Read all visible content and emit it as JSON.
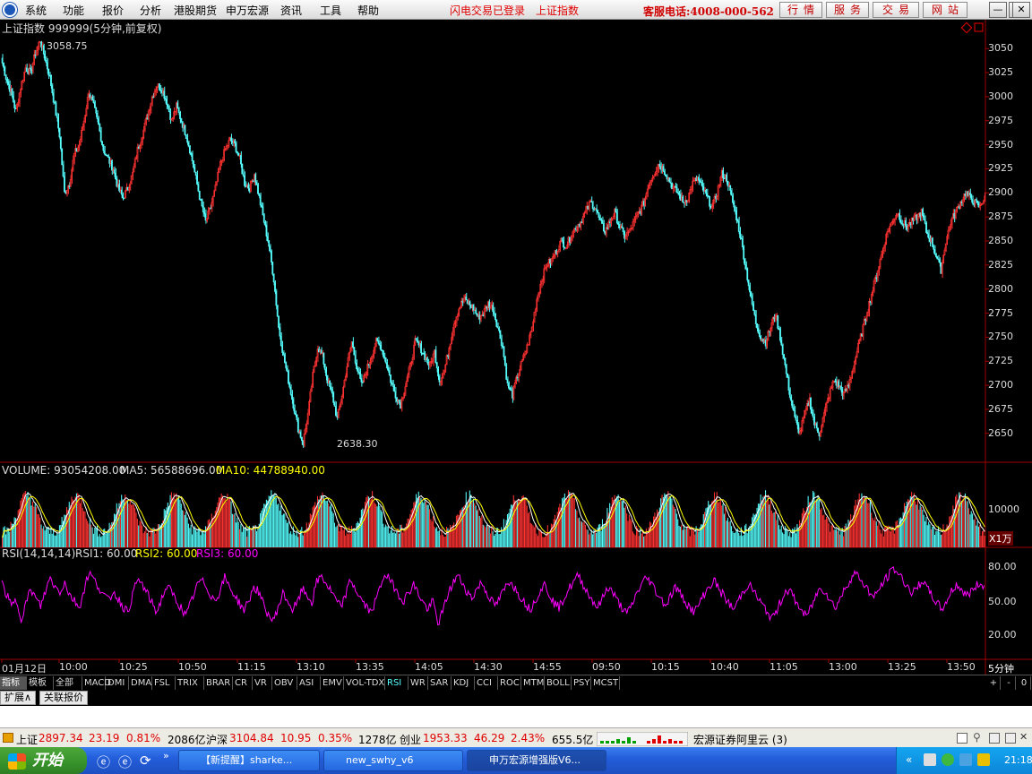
{
  "menubar": {
    "items": [
      "系统",
      "功能",
      "报价",
      "分析",
      "港股期货",
      "申万宏源",
      "资讯",
      "工具",
      "帮助"
    ],
    "login_status": "闪电交易已登录",
    "current_index": "上证指数",
    "hotline": "客服电话:4008-000-562",
    "right_buttons": [
      "行情",
      "服务",
      "交易",
      "网站"
    ]
  },
  "main_chart": {
    "title_code": "上证指数 999999(5分钟,前复权)",
    "high_label": "3058.75",
    "low_label": "2638.30",
    "y_ticks": [
      "3050",
      "3025",
      "3000",
      "2975",
      "2950",
      "2925",
      "2900",
      "2875",
      "2850",
      "2825",
      "2800",
      "2775",
      "2750",
      "2725",
      "2700",
      "2675",
      "2650"
    ]
  },
  "volume": {
    "label": "VOLUME: 93054208.00",
    "ma5": "MA5: 56588696.00",
    "ma10": "MA10: 44788940.00",
    "y_tick": "10000",
    "unit": "X1万"
  },
  "rsi": {
    "label": "RSI(14,14,14)",
    "rsi1": "RSI1: 60.00",
    "rsi2": "RSI2: 60.00",
    "rsi3": "RSI3: 60.00",
    "y_ticks": [
      "80.00",
      "50.00",
      "20.00"
    ]
  },
  "x_axis": {
    "labels": [
      "01月12日",
      "10:00",
      "10:25",
      "10:50",
      "11:15",
      "13:10",
      "13:35",
      "14:05",
      "14:30",
      "14:55",
      "09:50",
      "10:15",
      "10:40",
      "11:05",
      "13:00",
      "13:25",
      "13:50"
    ],
    "period": "5分钟"
  },
  "indicator_tabs": [
    "指标",
    "模板",
    "全部",
    "MACD",
    "DMI",
    "DMA",
    "FSL",
    "TRIX",
    "BRAR",
    "CR",
    "VR",
    "OBV",
    "ASI",
    "EMV",
    "VOL-TDX",
    "RSI",
    "WR",
    "SAR",
    "KDJ",
    "CCI",
    "ROC",
    "MTM",
    "BOLL",
    "PSY",
    "MCST"
  ],
  "tab_controls": [
    "+",
    "-",
    "0"
  ],
  "ext_tabs": [
    "扩展∧",
    "关联报价"
  ],
  "statusbar": {
    "sh_label": "上证",
    "sh_value": "2897.34",
    "sh_change": "23.19",
    "sh_pct": "0.81%",
    "sh_amount": "2086亿",
    "hs_label": "沪深",
    "hs_value": "3104.84",
    "hs_change": "10.95",
    "hs_pct": "0.35%",
    "hs_amount": "1278亿",
    "cy_label": "创业",
    "cy_value": "1953.33",
    "cy_change": "46.29",
    "cy_pct": "2.43%",
    "cy_amount": "655.5亿",
    "server": "宏源证券阿里云 (3)"
  },
  "taskbar": {
    "start": "开始",
    "buttons": [
      "【新提醒】sharke...",
      "new_swhy_v6",
      "申万宏源增强版V6..."
    ],
    "clock": "21:18"
  },
  "colors": {
    "up": "#ff3232",
    "down": "#54fcfc",
    "ma5": "#ffffff",
    "ma10": "#ffff00",
    "rsi3": "#ff00ff",
    "border": "#a00000"
  },
  "chart_data": {
    "type": "line",
    "title": "上证指数 999999(5分钟,前复权)",
    "series": [
      {
        "name": "上证指数",
        "values": [
          3040,
          3020,
          3005,
          2985,
          3010,
          3030,
          3025,
          3045,
          3058.75,
          3040,
          3020,
          2990,
          2960,
          2900,
          2910,
          2940,
          2950,
          2975,
          3005,
          2990,
          2970,
          2945,
          2935,
          2925,
          2905,
          2895,
          2905,
          2920,
          2945,
          2960,
          2980,
          3000,
          3012,
          3008,
          2995,
          2975,
          2990,
          2975,
          2960,
          2940,
          2915,
          2890,
          2870,
          2885,
          2905,
          2930,
          2945,
          2955,
          2950,
          2935,
          2910,
          2905,
          2920,
          2895,
          2870,
          2845,
          2810,
          2760,
          2730,
          2705,
          2680,
          2655,
          2640,
          2670,
          2710,
          2740,
          2730,
          2705,
          2690,
          2665,
          2690,
          2720,
          2745,
          2720,
          2700,
          2715,
          2730,
          2745,
          2740,
          2725,
          2705,
          2690,
          2680,
          2700,
          2720,
          2745,
          2740,
          2730,
          2720,
          2735,
          2705,
          2715,
          2740,
          2765,
          2780,
          2790,
          2785,
          2780,
          2770,
          2775,
          2785,
          2780,
          2760,
          2740,
          2700,
          2690,
          2710,
          2725,
          2740,
          2760,
          2790,
          2810,
          2825,
          2830,
          2840,
          2850,
          2845,
          2855,
          2865,
          2870,
          2880,
          2890,
          2885,
          2870,
          2860,
          2870,
          2880,
          2865,
          2855,
          2860,
          2870,
          2880,
          2890,
          2910,
          2920,
          2930,
          2925,
          2915,
          2905,
          2900,
          2890,
          2895,
          2910,
          2915,
          2905,
          2895,
          2885,
          2900,
          2920,
          2915,
          2895,
          2875,
          2850,
          2820,
          2790,
          2765,
          2750,
          2745,
          2760,
          2775,
          2750,
          2720,
          2690,
          2665,
          2650,
          2670,
          2685,
          2660,
          2650,
          2670,
          2690,
          2705,
          2700,
          2690,
          2700,
          2720,
          2740,
          2760,
          2780,
          2800,
          2820,
          2840,
          2860,
          2870,
          2880,
          2870,
          2865,
          2870,
          2875,
          2880,
          2860,
          2850,
          2835,
          2820,
          2850,
          2870,
          2880,
          2890,
          2900,
          2895,
          2890,
          2885,
          2897.34
        ]
      },
      {
        "name": "RSI3",
        "values": [
          65,
          55,
          45,
          50,
          35,
          48,
          60,
          52,
          45,
          58,
          70,
          62,
          58,
          66,
          55,
          50,
          44,
          60,
          75,
          68,
          62,
          55,
          50,
          58,
          52,
          45,
          40,
          55,
          68,
          64,
          56,
          48,
          40,
          52,
          62,
          58,
          50,
          44,
          36,
          48,
          60,
          68,
          64,
          56,
          50,
          58,
          70,
          62,
          55,
          48,
          42,
          50,
          62,
          58,
          46,
          38,
          32,
          44,
          56,
          50,
          42,
          48,
          60,
          55,
          48,
          66,
          72,
          64,
          58,
          50,
          44,
          56,
          68,
          60,
          52,
          46,
          40,
          48,
          60,
          74,
          68,
          62,
          55,
          50,
          58,
          64,
          56,
          48,
          42,
          50,
          30,
          40,
          55,
          64,
          72,
          66,
          58,
          52,
          60,
          66,
          58,
          50,
          46,
          54,
          62,
          68,
          60,
          54,
          48,
          42,
          50,
          58,
          64,
          56,
          48,
          44,
          52,
          60,
          66,
          72,
          64,
          56,
          50,
          44,
          52,
          62,
          58,
          50,
          44,
          38,
          46,
          56,
          64,
          70,
          66,
          58,
          52,
          46,
          54,
          62,
          56,
          50,
          44,
          40,
          48,
          56,
          62,
          68,
          60,
          54,
          48,
          42,
          50,
          58,
          64,
          60,
          52,
          46,
          40,
          34,
          42,
          52,
          60,
          56,
          48,
          42,
          36,
          44,
          54,
          62,
          58,
          50,
          44,
          52,
          60,
          68,
          74,
          70,
          64,
          58,
          52,
          60,
          66,
          72,
          78,
          74,
          68,
          62,
          56,
          62,
          68,
          60,
          54,
          48,
          42,
          50,
          58,
          64,
          60,
          54,
          58,
          62,
          66,
          60
        ]
      }
    ],
    "ylim": [
      2620,
      3080
    ]
  }
}
